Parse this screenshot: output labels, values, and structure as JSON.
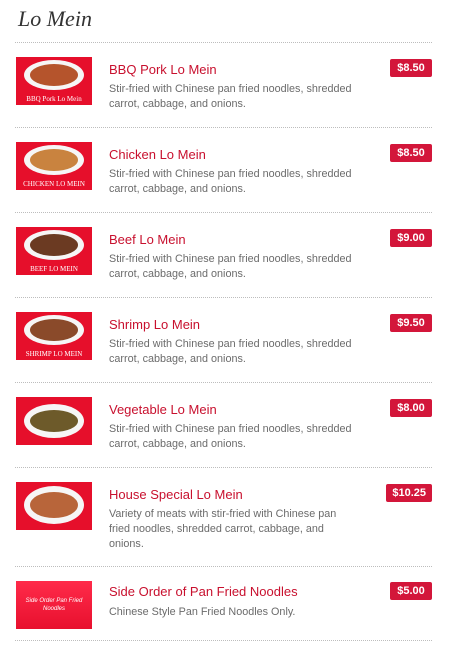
{
  "section": {
    "title": "Lo Mein"
  },
  "items": [
    {
      "name": "BBQ Pork Lo Mein",
      "description": "Stir-fried with Chinese pan fried noodles, shredded carrot, cabbage, and onions.",
      "price": "$8.50",
      "image_caption": "BBQ Pork Lo Mein",
      "food_color": "#b5542c"
    },
    {
      "name": "Chicken Lo Mein",
      "description": "Stir-fried with Chinese pan fried noodles, shredded carrot, cabbage, and onions.",
      "price": "$8.50",
      "image_caption": "CHICKEN LO MEIN",
      "food_color": "#c9833f"
    },
    {
      "name": "Beef Lo Mein",
      "description": "Stir-fried with Chinese pan fried noodles, shredded carrot, cabbage, and onions.",
      "price": "$9.00",
      "image_caption": "BEEF LO MEIN",
      "food_color": "#6b3a22"
    },
    {
      "name": "Shrimp Lo Mein",
      "description": "Stir-fried with Chinese pan fried noodles, shredded carrot, cabbage, and onions.",
      "price": "$9.50",
      "image_caption": "SHRIMP LO MEIN",
      "food_color": "#8a4a2a"
    },
    {
      "name": "Vegetable Lo Mein",
      "description": "Stir-fried with Chinese pan fried noodles, shredded carrot, cabbage, and onions.",
      "price": "$8.00",
      "image_caption": "",
      "food_color": "#6d5a2a"
    },
    {
      "name": "House Special Lo Mein",
      "description": "Variety of meats with stir-fried with Chinese pan fried noodles, shredded carrot, cabbage, and onions.",
      "price": "$10.25",
      "image_caption": "",
      "food_color": "#b8653a"
    },
    {
      "name": "Side Order of Pan Fried Noodles",
      "description": "Chinese Style Pan Fried Noodles Only.",
      "price": "$5.00",
      "image_caption": "Side Order Pan Fried Noodles",
      "food_color": ""
    }
  ],
  "colors": {
    "accent": "#c8102e",
    "price_bg": "#d3163a",
    "thumb_bg": "#e60f2b"
  }
}
